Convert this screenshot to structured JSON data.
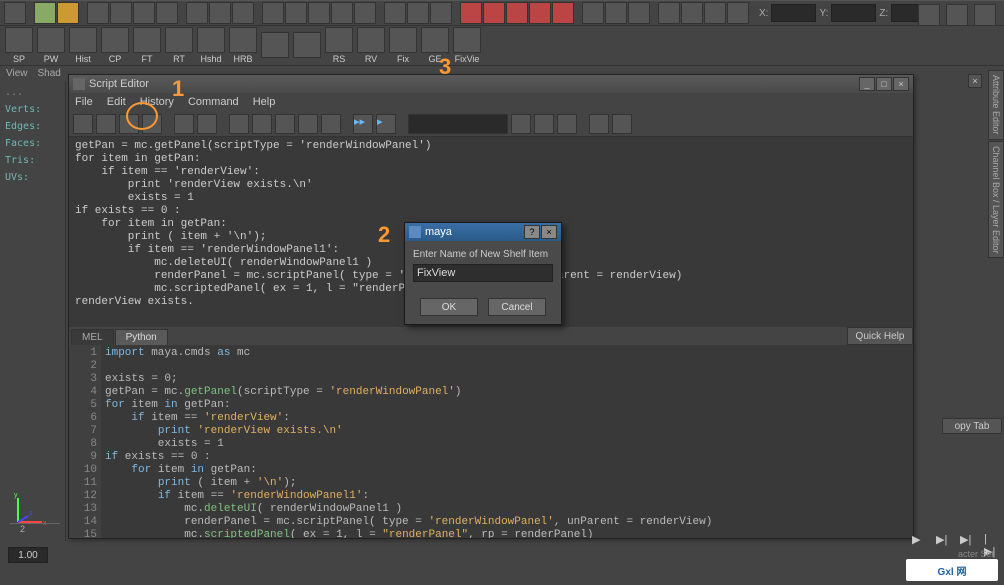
{
  "annotations": {
    "n1": "1",
    "n2": "2",
    "n3": "3"
  },
  "top_toolbar": {
    "x_label": "X:",
    "y_label": "Y:",
    "z_label": "Z:",
    "x_val": "",
    "y_val": "",
    "z_val": ""
  },
  "shelves": [
    {
      "label": "SP"
    },
    {
      "label": "PW"
    },
    {
      "label": "Hist"
    },
    {
      "label": "CP"
    },
    {
      "label": "FT"
    },
    {
      "label": "RT"
    },
    {
      "label": "Hshd"
    },
    {
      "label": "HRB"
    },
    {
      "label": ""
    },
    {
      "label": ""
    },
    {
      "label": "RS"
    },
    {
      "label": "RV"
    },
    {
      "label": "Fix"
    },
    {
      "label": "GE"
    },
    {
      "label": "FixVie"
    }
  ],
  "views": {
    "v1": "View",
    "v2": "Shad"
  },
  "left_panel": {
    "a": "...",
    "verts": "Verts:",
    "edges": "Edges:",
    "faces": "Faces:",
    "tris": "Tris:",
    "uvs": "UVs:"
  },
  "script_editor": {
    "title": "Script Editor",
    "menu": [
      "File",
      "Edit",
      "History",
      "Command",
      "Help"
    ],
    "log": "getPan = mc.getPanel(scriptType = 'renderWindowPanel')\nfor item in getPan:\n    if item == 'renderView':\n        print 'renderView exists.\\n'\n        exists = 1\nif exists == 0 :\n    for item in getPan:\n        print ( item + '\\n');\n        if item == 'renderWindowPanel1':\n            mc.deleteUI( renderWindowPanel1 )\n            renderPanel = mc.scriptPanel( type = 'renderWindowPanel', unParent = renderView)\n            mc.scriptedPanel( ex = 1, l = \"renderPanel\", rp = renderPanel)\nrenderView exists.",
    "tabs": {
      "mel": "MEL",
      "python": "Python"
    },
    "quick_help": "Quick Help",
    "copy_tab": "opy Tab",
    "code_lines": [
      {
        "n": "1",
        "html": "<span class='kw'>import</span> maya.cmds <span class='kw'>as</span> mc"
      },
      {
        "n": "2",
        "html": ""
      },
      {
        "n": "3",
        "html": "exists = 0;"
      },
      {
        "n": "4",
        "html": "getPan = mc.<span class='fn'>getPanel</span>(scriptType = <span class='str'>'renderWindowPanel'</span>)"
      },
      {
        "n": "5",
        "html": "<span class='kw'>for</span> item <span class='kw'>in</span> getPan:"
      },
      {
        "n": "6",
        "html": "    <span class='kw'>if</span> item == <span class='str'>'renderView'</span>:"
      },
      {
        "n": "7",
        "html": "        <span class='kw'>print</span> <span class='str'>'renderView exists.\\n'</span>"
      },
      {
        "n": "8",
        "html": "        exists = 1"
      },
      {
        "n": "9",
        "html": "<span class='kw'>if</span> exists == 0 :"
      },
      {
        "n": "10",
        "html": "    <span class='kw'>for</span> item <span class='kw'>in</span> getPan:"
      },
      {
        "n": "11",
        "html": "        <span class='kw'>print</span> ( item + <span class='str'>'\\n'</span>);"
      },
      {
        "n": "12",
        "html": "        <span class='kw'>if</span> item == <span class='str'>'renderWindowPanel1'</span>:"
      },
      {
        "n": "13",
        "html": "            mc.<span class='fn'>deleteUI</span>( renderWindowPanel1 )"
      },
      {
        "n": "14",
        "html": "            renderPanel = mc.scriptPanel( type = <span class='str'>'renderWindowPanel'</span>, unParent = renderView)"
      },
      {
        "n": "15",
        "html": "            mc.<span class='fn'>scriptedPanel</span>( ex = 1, l = <span class='str'>\"renderPanel\"</span>, rp = renderPanel)"
      }
    ]
  },
  "dialog": {
    "title": "maya",
    "label": "Enter Name of New Shelf Item",
    "value": "FixView",
    "ok": "OK",
    "cancel": "Cancel"
  },
  "right_tabs": {
    "t1": "Attribute Editor",
    "t2": "Channel Box / Layer Editor"
  },
  "bottom": {
    "frame": "1.00",
    "tick": "2",
    "char": "acter Set"
  },
  "logo": {
    "text": "Gxl 网",
    "url": "www.gxlsystem.com"
  }
}
